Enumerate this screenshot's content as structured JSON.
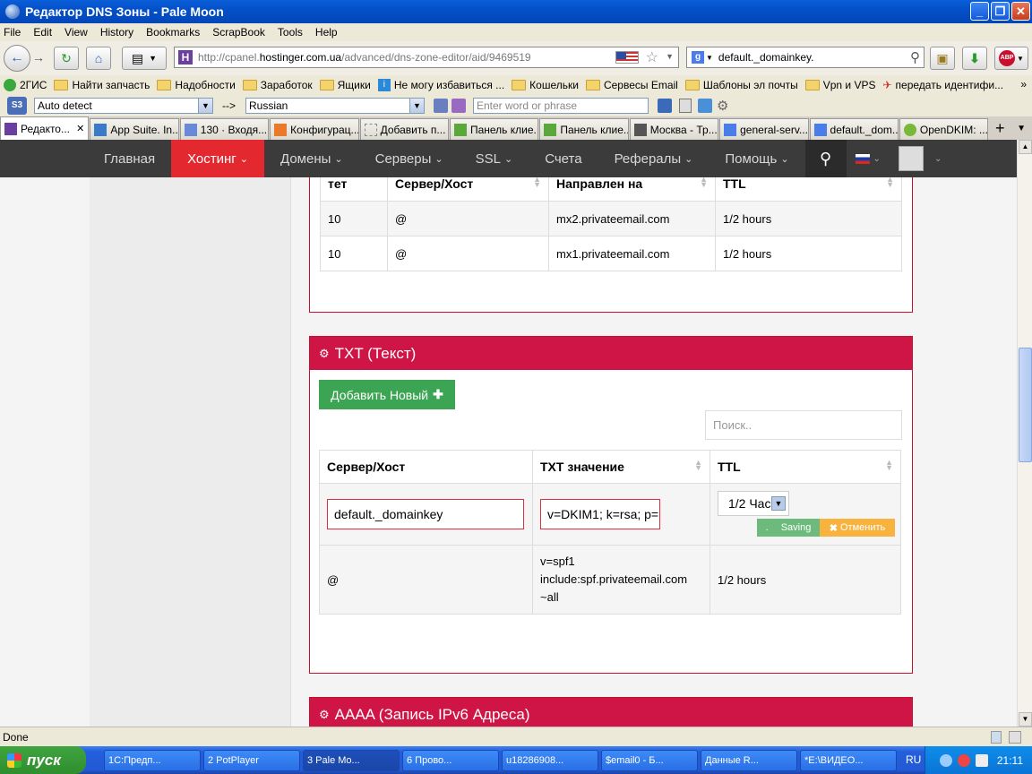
{
  "window": {
    "title": "Редактор DNS Зоны - Pale Moon"
  },
  "menu": [
    "File",
    "Edit",
    "View",
    "History",
    "Bookmarks",
    "ScrapBook",
    "Tools",
    "Help"
  ],
  "address": {
    "scheme": "http://cpanel.",
    "host": "hostinger.com.ua",
    "path": "/advanced/dns-zone-editor/aid/9469519"
  },
  "search": {
    "value": "default._domainkey."
  },
  "bookmarks": [
    "2ГИС",
    "Найти запчасть",
    "Надобности",
    "Заработок",
    "Ящики",
    "Не могу избавиться ...",
    "Кошельки",
    "Сервесы Email",
    "Шаблоны эл почты",
    "Vpn и VPS",
    "передать идентифи..."
  ],
  "translate": {
    "from": "Auto detect",
    "arrow": "-->",
    "to": "Russian",
    "placeholder": "Enter word or phrase"
  },
  "tabs": [
    "Редакто...",
    "App Suite. In...",
    "130 · Входя...",
    "Конфигурац...",
    "Добавить п...",
    "Панель клие...",
    "Панель клие...",
    "Москва - Тр...",
    "general-serv...",
    "default._dom...",
    "OpenDKIM: ..."
  ],
  "site_nav": {
    "items": [
      "Главная",
      "Хостинг",
      "Домены",
      "Серверы",
      "SSL",
      "Счета",
      "Рефералы",
      "Помощь"
    ]
  },
  "mx_table": {
    "headers": [
      "тет",
      "Сервер/Хост",
      "Направлен на",
      "TTL"
    ],
    "rows": [
      [
        "10",
        "@",
        "mx2.privateemail.com",
        "1/2 hours"
      ],
      [
        "10",
        "@",
        "mx1.privateemail.com",
        "1/2 hours"
      ]
    ]
  },
  "txt_panel": {
    "title": "TXT (Текст)",
    "add_button": "Добавить Новый",
    "search_placeholder": "Поиск..",
    "headers": [
      "Сервер/Хост",
      "TXT значение",
      "TTL"
    ],
    "edit_row": {
      "host": "default._domainkey",
      "value": "v=DKIM1; k=rsa; p=",
      "ttl": "1/2 Час",
      "saving": "Saving",
      "cancel": "Отменить"
    },
    "row": {
      "host": "@",
      "value_line1": "v=spf1",
      "value_line2": "include:spf.privateemail.com",
      "value_line3": "~all",
      "ttl": "1/2 hours"
    }
  },
  "aaaa_panel": {
    "title": "AAAA (Запись IPv6 Адреса)"
  },
  "status": "Done",
  "taskbar": {
    "start": "пуск",
    "tasks": [
      "1С:Предп...",
      "2 PotPlayer",
      "3 Pale Mo...",
      "6 Прово...",
      "u18286908...",
      "$email0 - Б...",
      "Данные R...",
      "*E:\\ВИДЕО..."
    ],
    "lang": "RU",
    "time": "21:11"
  },
  "colors": {
    "accent_red": "#e4282f",
    "panel_header": "#cf1446",
    "green": "#3ba553",
    "cancel_orange": "#f7b33d"
  }
}
